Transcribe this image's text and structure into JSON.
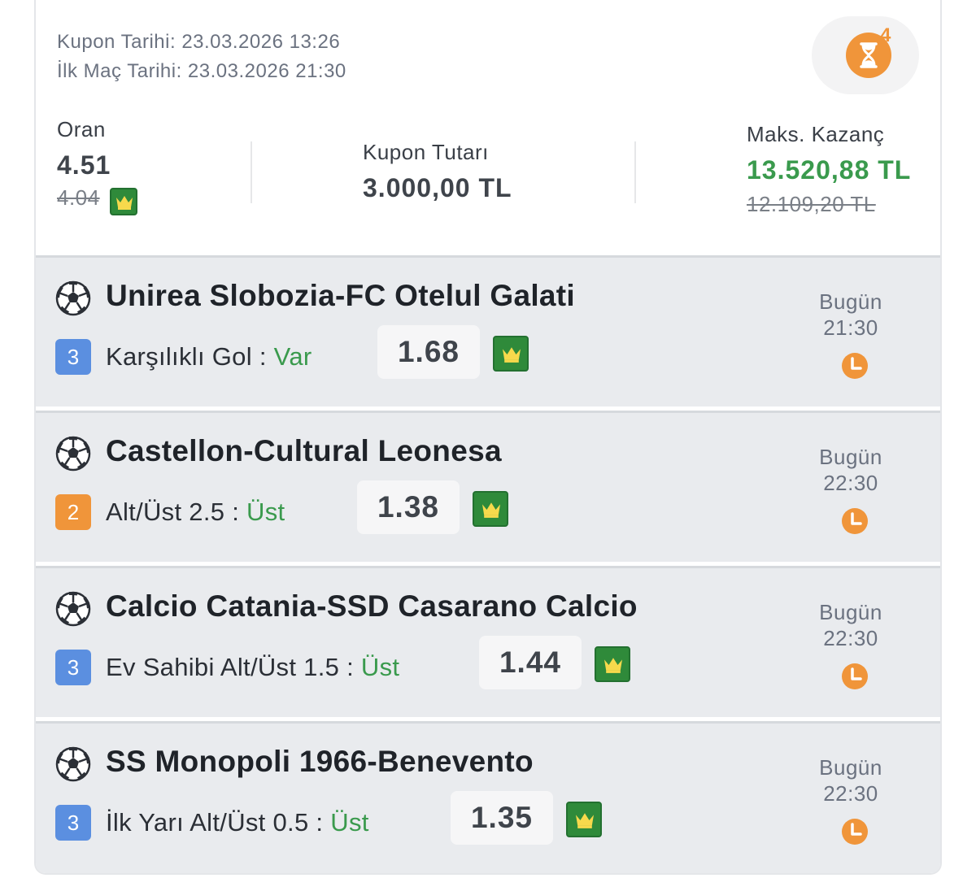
{
  "coupon": {
    "coupon_date_label": "Kupon Tarihi: 23.03.2026 13:26",
    "first_match_label": "İlk Maç Tarihi: 23.03.2026 21:30",
    "timer_count": "4",
    "odds": {
      "label": "Oran",
      "value": "4.51",
      "old_value": "4.04"
    },
    "stake": {
      "label": "Kupon Tutarı",
      "value": "3.000,00 TL"
    },
    "max_win": {
      "label": "Maks. Kazanç",
      "value": "13.520,88 TL",
      "old_value": "12.109,20 TL"
    }
  },
  "colors": {
    "green": "#3a9a4d",
    "orange": "#f0953a",
    "blue": "#5b8fe0",
    "row_bg": "#e9ebee"
  },
  "matches": [
    {
      "title": "Unirea Slobozia-FC Otelul Galati",
      "badge": "3",
      "badge_color": "blue",
      "market": "Karşılıklı Gol",
      "separator": " : ",
      "selection": "Var",
      "odd": "1.68",
      "day": "Bugün",
      "time": "21:30"
    },
    {
      "title": "Castellon-Cultural Leonesa",
      "badge": "2",
      "badge_color": "orange",
      "market": "Alt/Üst 2.5",
      "separator": " : ",
      "selection": "Üst",
      "odd": "1.38",
      "day": "Bugün",
      "time": "22:30"
    },
    {
      "title": "Calcio Catania-SSD Casarano Calcio",
      "badge": "3",
      "badge_color": "blue",
      "market": "Ev Sahibi Alt/Üst 1.5",
      "separator": " : ",
      "selection": "Üst",
      "odd": "1.44",
      "day": "Bugün",
      "time": "22:30"
    },
    {
      "title": "SS Monopoli 1966-Benevento",
      "badge": "3",
      "badge_color": "blue",
      "market": "İlk Yarı Alt/Üst 0.5",
      "separator": " : ",
      "selection": "Üst",
      "odd": "1.35",
      "day": "Bugün",
      "time": "22:30"
    }
  ]
}
